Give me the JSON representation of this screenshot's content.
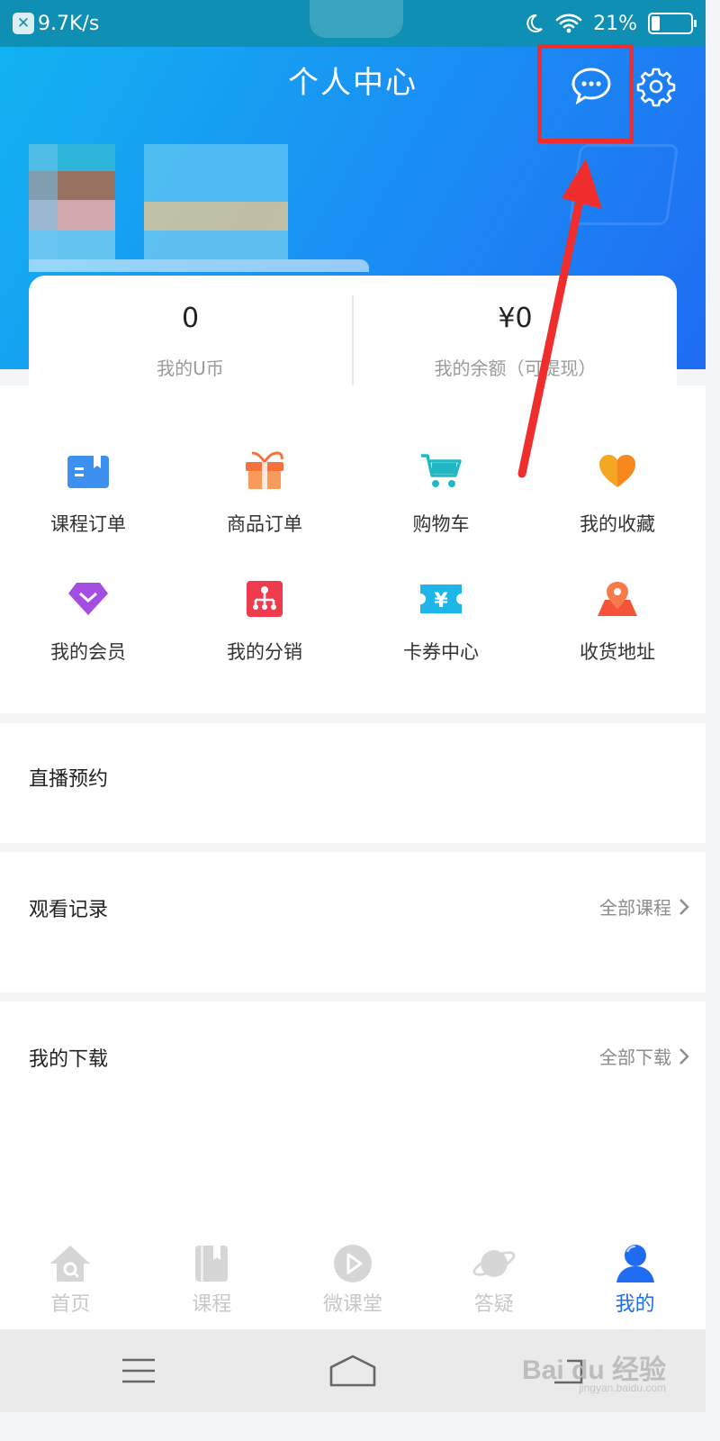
{
  "status_bar": {
    "net_speed": "9.7K/s",
    "battery_text": "21%",
    "battery_level": 0.21
  },
  "header": {
    "title": "个人中心",
    "message_icon": "chat-bubble-icon",
    "settings_icon": "gear-icon"
  },
  "stats": [
    {
      "value": "0",
      "label": "我的U币"
    },
    {
      "value": "¥0",
      "label": "我的余额（可提现）"
    }
  ],
  "grid": [
    {
      "label": "课程订单",
      "icon": "course-order-icon",
      "color": "#3d8ff0"
    },
    {
      "label": "商品订单",
      "icon": "gift-icon",
      "color": "#f5723a"
    },
    {
      "label": "购物车",
      "icon": "cart-icon",
      "color": "#21b8c4"
    },
    {
      "label": "我的收藏",
      "icon": "heart-icon",
      "color": "#f5a623"
    },
    {
      "label": "我的会员",
      "icon": "diamond-icon",
      "color": "#a34ee0"
    },
    {
      "label": "我的分销",
      "icon": "distribution-icon",
      "color": "#ef3b4d"
    },
    {
      "label": "卡券中心",
      "icon": "coupon-icon",
      "color": "#1eb6e8"
    },
    {
      "label": "收货地址",
      "icon": "location-icon",
      "color": "#f4533a"
    }
  ],
  "sections": {
    "live": {
      "title": "直播预约"
    },
    "history": {
      "title": "观看记录",
      "more": "全部课程"
    },
    "downloads": {
      "title": "我的下载",
      "more": "全部下载"
    }
  },
  "tabs": [
    {
      "label": "首页",
      "icon": "home-icon",
      "active": false
    },
    {
      "label": "课程",
      "icon": "book-icon",
      "active": false
    },
    {
      "label": "微课堂",
      "icon": "play-icon",
      "active": false
    },
    {
      "label": "答疑",
      "icon": "planet-icon",
      "active": false
    },
    {
      "label": "我的",
      "icon": "user-icon",
      "active": true
    }
  ],
  "watermark": {
    "main": "Bai du 经验",
    "sub": "jingyan.baidu.com"
  },
  "colors": {
    "accent": "#1f6cf2",
    "highlight": "#ef2d2d"
  }
}
